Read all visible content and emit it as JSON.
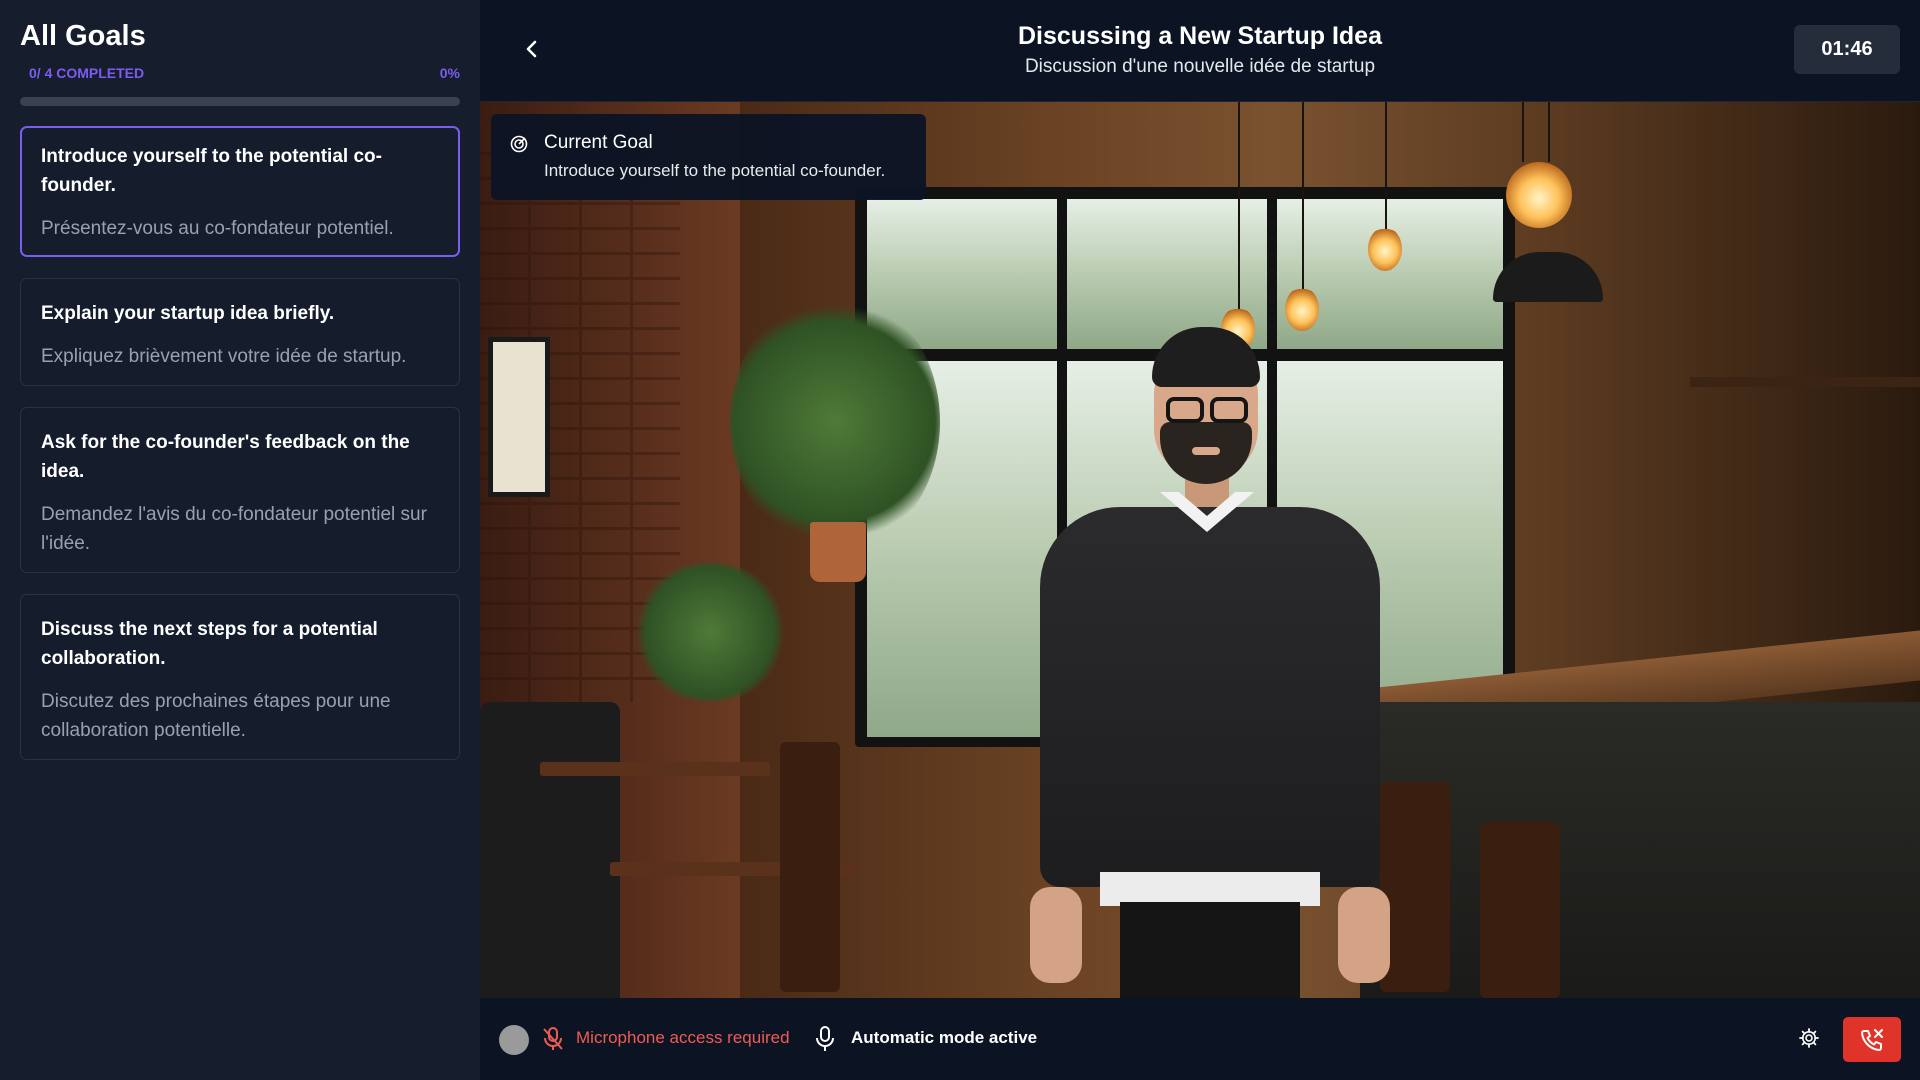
{
  "sidebar": {
    "title": "All Goals",
    "completed_label": "0/ 4 COMPLETED",
    "percent_label": "0%",
    "progress": 0,
    "goals": [
      {
        "en": "Introduce yourself to the potential co-founder.",
        "fr": "Présentez-vous au co-fondateur potentiel."
      },
      {
        "en": "Explain your startup idea briefly.",
        "fr": "Expliquez brièvement votre idée de startup."
      },
      {
        "en": "Ask for the co-founder's feedback on the idea.",
        "fr": "Demandez l'avis du co-fondateur potentiel sur l'idée."
      },
      {
        "en": "Discuss the next steps for a potential collaboration.",
        "fr": "Discutez des prochaines étapes pour une collaboration potentielle."
      }
    ]
  },
  "header": {
    "title": "Discussing a New Startup Idea",
    "subtitle": "Discussion d'une nouvelle idée de startup",
    "timer": "01:46"
  },
  "current_goal": {
    "title": "Current Goal",
    "text": "Introduce yourself to the potential co-founder."
  },
  "footer": {
    "mic_status": "Microphone access required",
    "mode_status": "Automatic mode active"
  },
  "colors": {
    "accent": "#7c5cf0",
    "error": "#ef5b54",
    "hangup": "#e0342b"
  },
  "icons": [
    "back-chevron-icon",
    "target-icon",
    "mic-off-icon",
    "mic-icon",
    "gear-icon",
    "phone-hangup-icon"
  ]
}
